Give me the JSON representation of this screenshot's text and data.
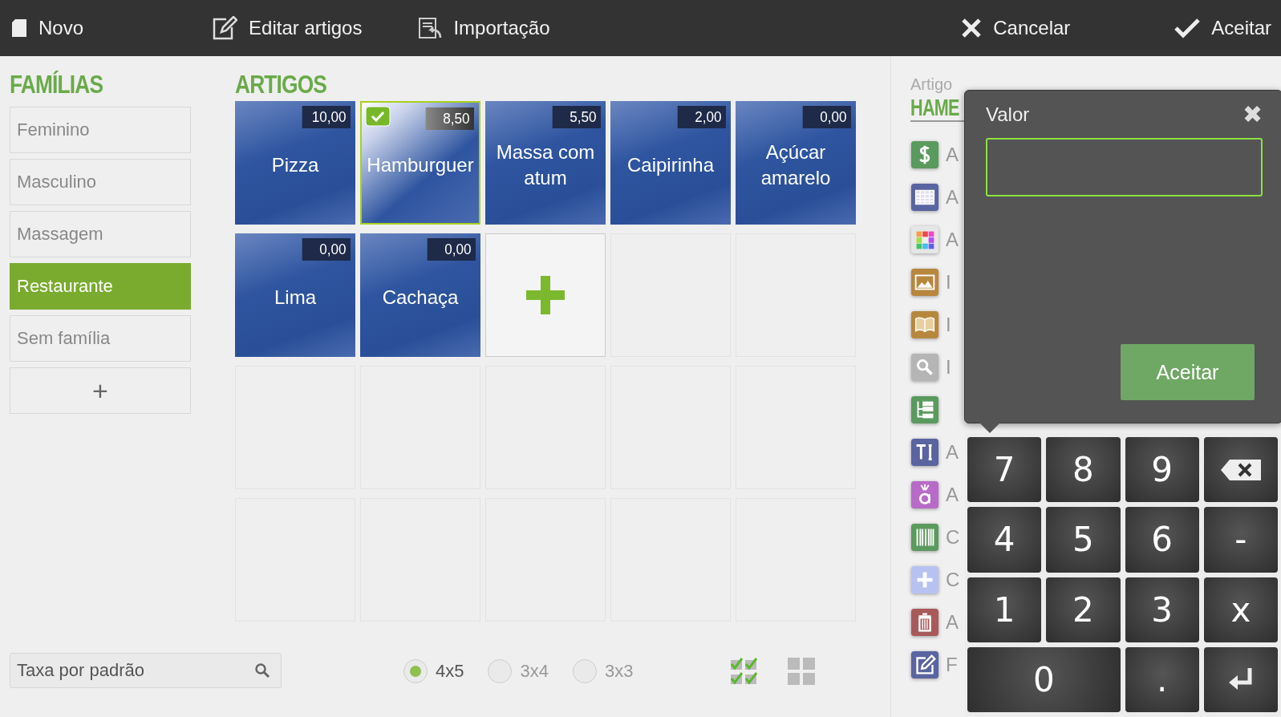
{
  "toolbar": {
    "left": [
      {
        "kind": "new",
        "label": "Novo"
      },
      {
        "kind": "edit",
        "label": "Editar artigos"
      },
      {
        "kind": "import",
        "label": "Importação"
      }
    ],
    "right": [
      {
        "kind": "cancel",
        "label": "Cancelar"
      },
      {
        "kind": "accept",
        "label": "Aceitar"
      }
    ]
  },
  "families": {
    "title": "FAMÍLIAS",
    "items": [
      {
        "label": "Feminino",
        "selected": false
      },
      {
        "label": "Masculino",
        "selected": false
      },
      {
        "label": "Massagem",
        "selected": false
      },
      {
        "label": "Restaurante",
        "selected": true
      },
      {
        "label": "Sem família",
        "selected": false
      }
    ],
    "add_label": "+"
  },
  "articles": {
    "title": "ARTIGOS",
    "tiles": [
      {
        "kind": "article",
        "name": "Pizza",
        "price": "10,00",
        "selected": false
      },
      {
        "kind": "article",
        "name": "Hamburguer",
        "price": "8,50",
        "selected": true
      },
      {
        "kind": "article",
        "name": "Massa com atum",
        "price": "5,50",
        "selected": false
      },
      {
        "kind": "article",
        "name": "Caipirinha",
        "price": "2,00",
        "selected": false
      },
      {
        "kind": "article",
        "name": "Açúcar amarelo",
        "price": "0,00",
        "selected": false
      },
      {
        "kind": "article",
        "name": "Lima",
        "price": "0,00",
        "selected": false
      },
      {
        "kind": "article",
        "name": "Cachaça",
        "price": "0,00",
        "selected": false
      },
      {
        "kind": "add"
      },
      {
        "kind": "empty"
      },
      {
        "kind": "empty"
      },
      {
        "kind": "empty"
      },
      {
        "kind": "empty"
      },
      {
        "kind": "empty"
      },
      {
        "kind": "empty"
      },
      {
        "kind": "empty"
      },
      {
        "kind": "empty"
      },
      {
        "kind": "empty"
      },
      {
        "kind": "empty"
      },
      {
        "kind": "empty"
      },
      {
        "kind": "empty"
      }
    ]
  },
  "tax_field": {
    "placeholder": "Taxa por padrão"
  },
  "grid_sizes": [
    {
      "label": "4x5",
      "selected": true
    },
    {
      "label": "3x4",
      "selected": false
    },
    {
      "label": "3x3",
      "selected": false
    }
  ],
  "article_panel": {
    "caption": "Artigo",
    "title": "HAME",
    "actions": [
      {
        "kind": "price",
        "label": "A"
      },
      {
        "kind": "table",
        "label": "A"
      },
      {
        "kind": "colors",
        "label": "A"
      },
      {
        "kind": "image",
        "label": "I"
      },
      {
        "kind": "book",
        "label": "I"
      },
      {
        "kind": "search",
        "label": "I"
      },
      {
        "kind": "tree"
      },
      {
        "kind": "text",
        "label": "A"
      },
      {
        "kind": "accent",
        "label": "A"
      },
      {
        "kind": "barcode",
        "label": "C"
      },
      {
        "kind": "plus",
        "label": "C"
      },
      {
        "kind": "trash",
        "label": "A"
      },
      {
        "kind": "note",
        "label": "F"
      }
    ]
  },
  "value_dialog": {
    "title": "Valor",
    "close": "✖",
    "button": "Aceitar"
  },
  "keypad": [
    {
      "kind": "key",
      "label": "7"
    },
    {
      "kind": "key",
      "label": "8"
    },
    {
      "kind": "key",
      "label": "9"
    },
    {
      "kind": "backspace"
    },
    {
      "kind": "key",
      "label": "4"
    },
    {
      "kind": "key",
      "label": "5"
    },
    {
      "kind": "key",
      "label": "6"
    },
    {
      "kind": "key",
      "label": "-"
    },
    {
      "kind": "key",
      "label": "1"
    },
    {
      "kind": "key",
      "label": "2"
    },
    {
      "kind": "key",
      "label": "3"
    },
    {
      "kind": "key",
      "label": "x"
    },
    {
      "kind": "wide",
      "label": "0"
    },
    {
      "kind": "key",
      "label": "."
    },
    {
      "kind": "enter"
    }
  ]
}
